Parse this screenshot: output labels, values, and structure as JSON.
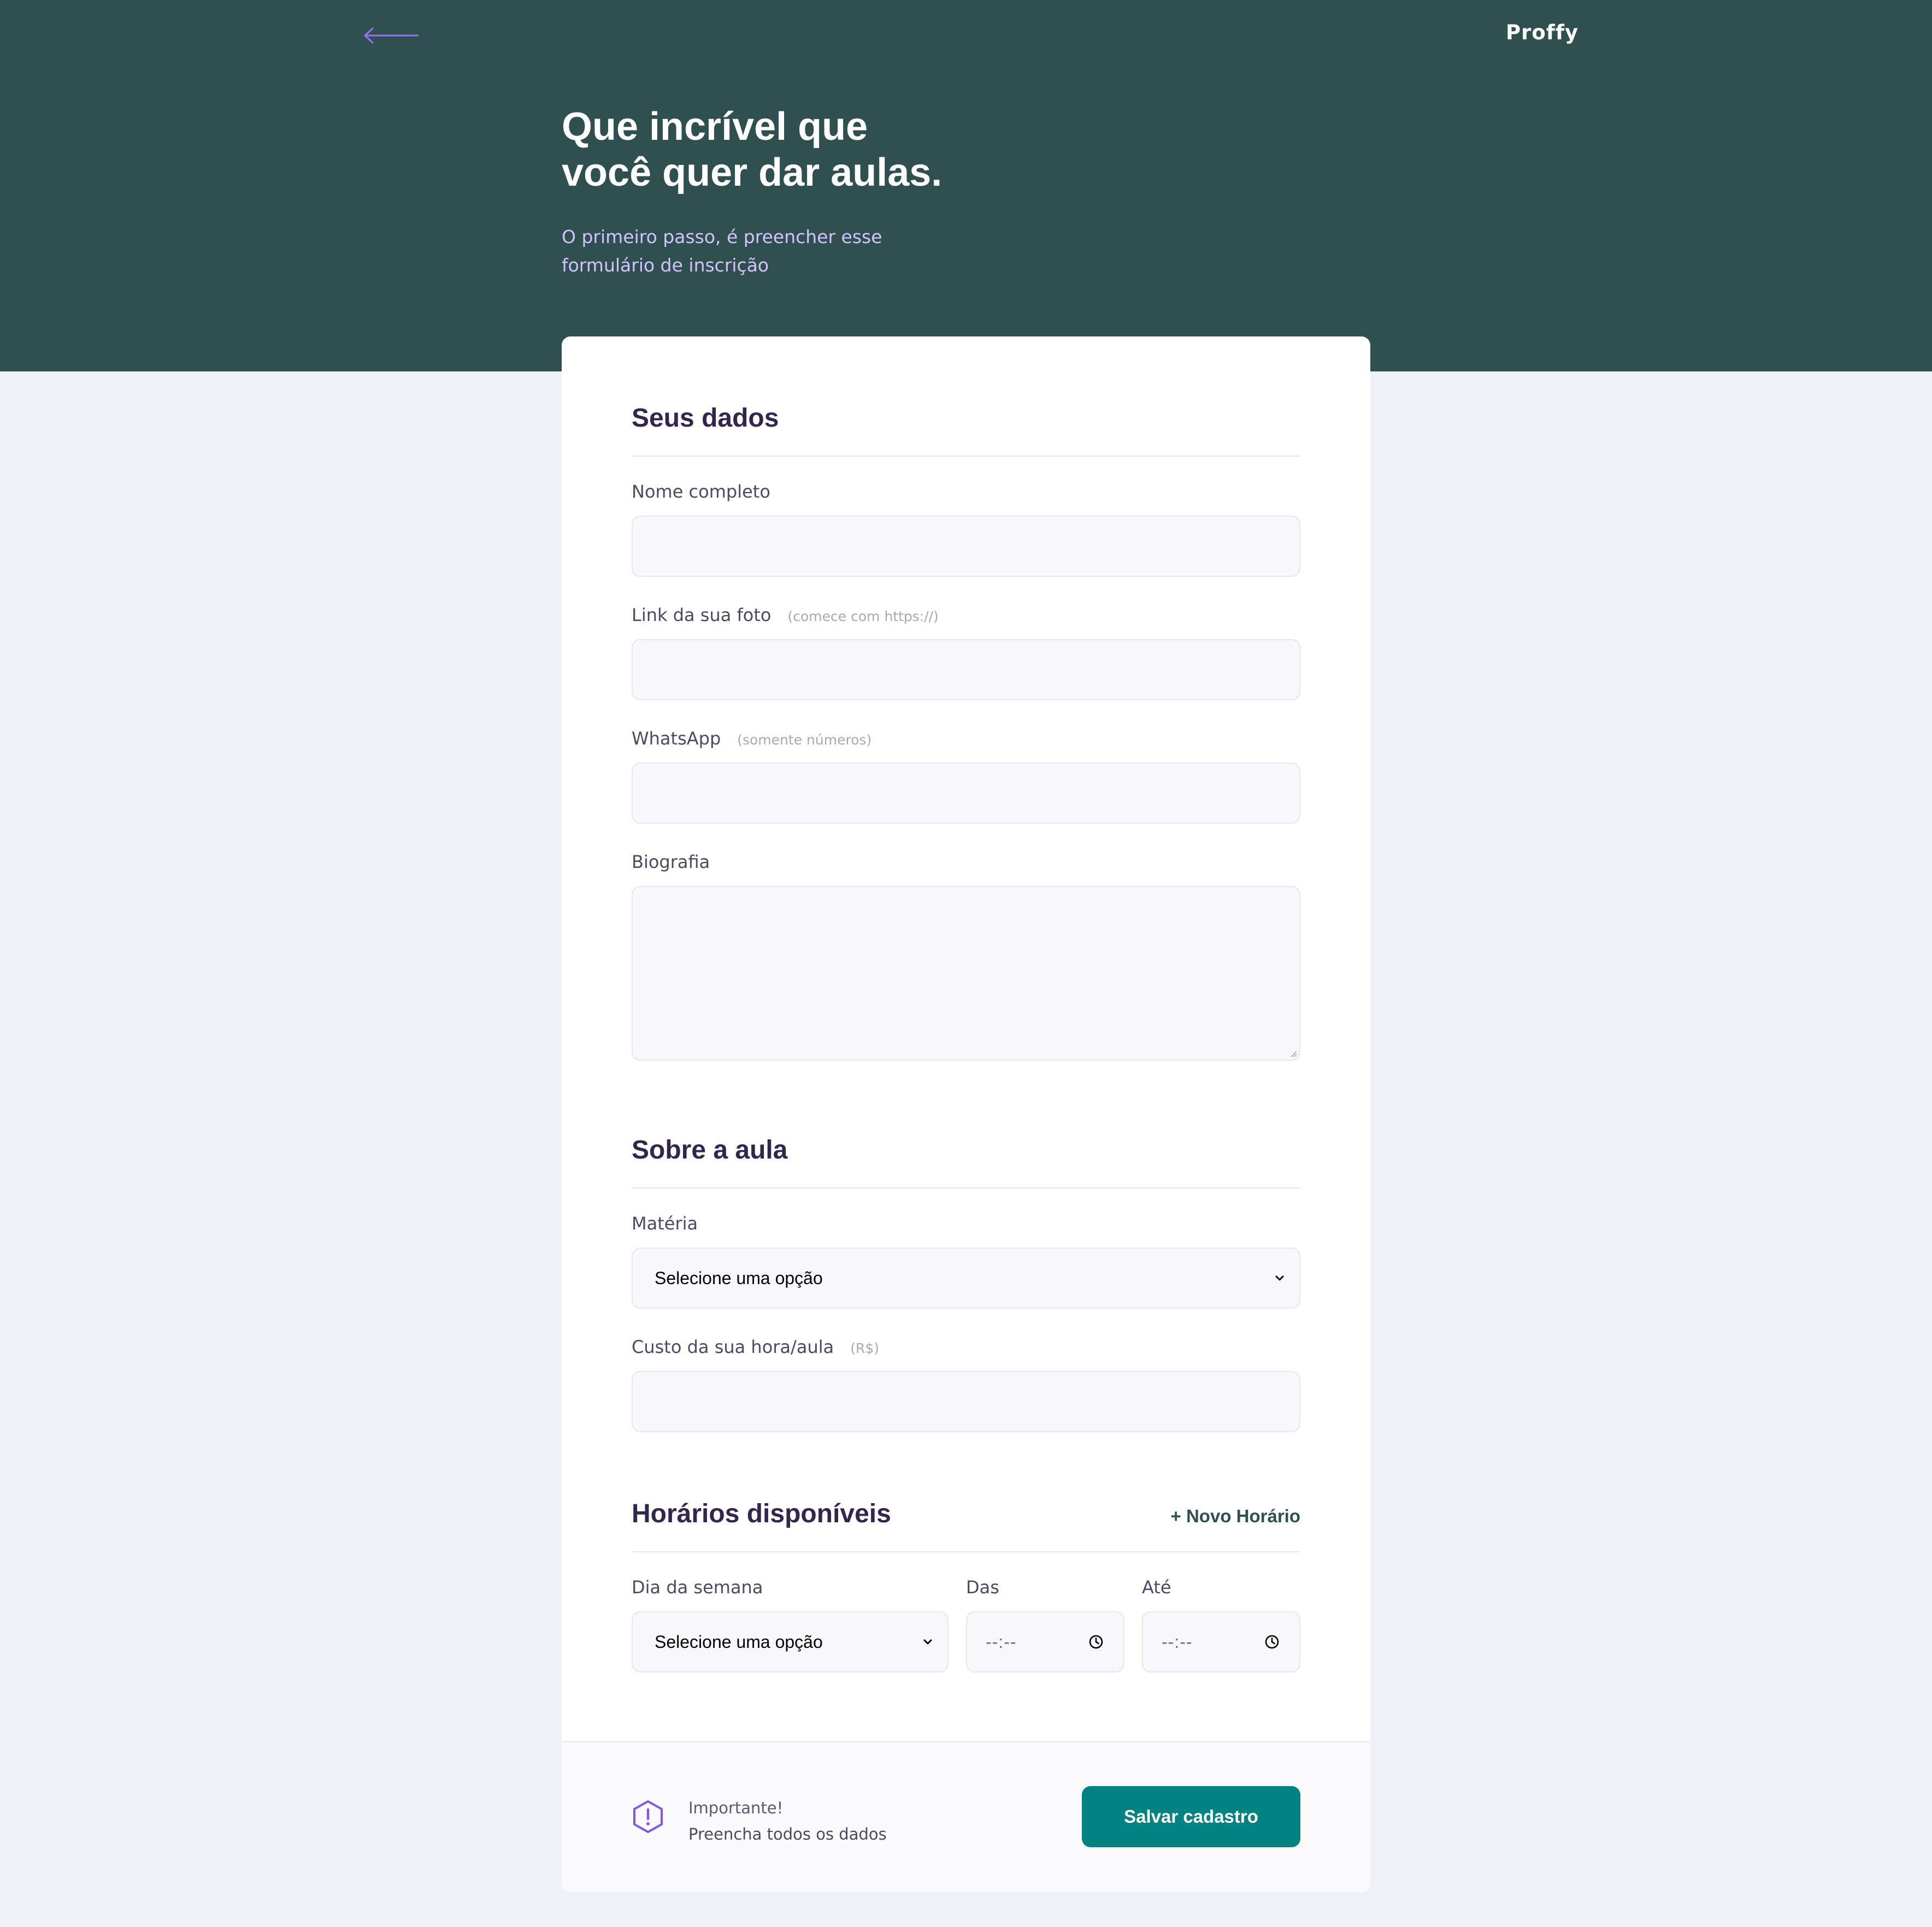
{
  "header": {
    "logo": "Proffy",
    "title_line1": "Que incrível que",
    "title_line2": "você quer dar aulas.",
    "subtitle_line1": "O primeiro passo, é preencher esse",
    "subtitle_line2": "formulário de inscrição"
  },
  "sections": {
    "personal": {
      "title": "Seus dados",
      "name_label": "Nome completo",
      "name_value": "",
      "photo_label": "Link da sua foto",
      "photo_hint": "(comece com https://)",
      "photo_value": "",
      "whatsapp_label": "WhatsApp",
      "whatsapp_hint": "(somente números)",
      "whatsapp_value": "",
      "bio_label": "Biografia",
      "bio_value": ""
    },
    "class": {
      "title": "Sobre a aula",
      "subject_label": "Matéria",
      "subject_selected": "Selecione uma opção",
      "cost_label": "Custo da sua hora/aula",
      "cost_hint": "(R$)",
      "cost_value": ""
    },
    "schedule": {
      "title": "Horários disponíveis",
      "add_label": "+ Novo Horário",
      "weekday_label": "Dia da semana",
      "weekday_selected": "Selecione uma opção",
      "from_label": "Das",
      "from_value": "--:--",
      "to_label": "Até",
      "to_value": "--:--"
    }
  },
  "footer": {
    "warning_title": "Importante!",
    "warning_text": "Preencha todos os dados",
    "save_label": "Salvar cadastro"
  },
  "icons": {
    "back": "arrow-left-icon",
    "warning": "warning-hexagon-icon",
    "dropdown": "chevron-down-icon",
    "clock": "clock-icon"
  },
  "colors": {
    "header_bg": "#305050",
    "page_bg": "#F0F0F7",
    "accent_purple": "#8257E5",
    "subtitle": "#D4C2FF",
    "save_button": "#058282",
    "heading_text": "#32264D"
  }
}
